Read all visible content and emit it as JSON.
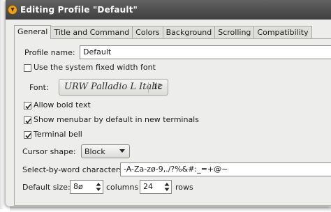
{
  "window": {
    "title": "Editing Profile \"Default\""
  },
  "tabs": [
    {
      "label": "General",
      "active": true
    },
    {
      "label": "Title and Command"
    },
    {
      "label": "Colors"
    },
    {
      "label": "Background"
    },
    {
      "label": "Scrolling"
    },
    {
      "label": "Compatibility"
    }
  ],
  "general": {
    "profile_name_label": "Profile name:",
    "profile_name_value": "Default",
    "system_font_label": "Use the system fixed width font",
    "system_font_checked": false,
    "font_label": "Font:",
    "font_name": "URW Palladio L Italic",
    "font_size": "12",
    "allow_bold_label": "Allow bold text",
    "allow_bold_checked": true,
    "show_menubar_label": "Show menubar by default in new terminals",
    "show_menubar_checked": true,
    "terminal_bell_label": "Terminal bell",
    "terminal_bell_checked": true,
    "cursor_shape_label": "Cursor shape:",
    "cursor_shape_value": "Block",
    "word_chars_label": "Select-by-word characters:",
    "word_chars_value": "-A-Za-zø-9,./?%&#:_=+@~",
    "default_size_label": "Default size:",
    "columns_value": "8ø",
    "columns_label": "columns",
    "rows_value": "24",
    "rows_label": "rows"
  },
  "colors": {
    "titlebar": "#4f4f4f",
    "window_bg": "#ededeb",
    "icon": "#e8a317"
  }
}
